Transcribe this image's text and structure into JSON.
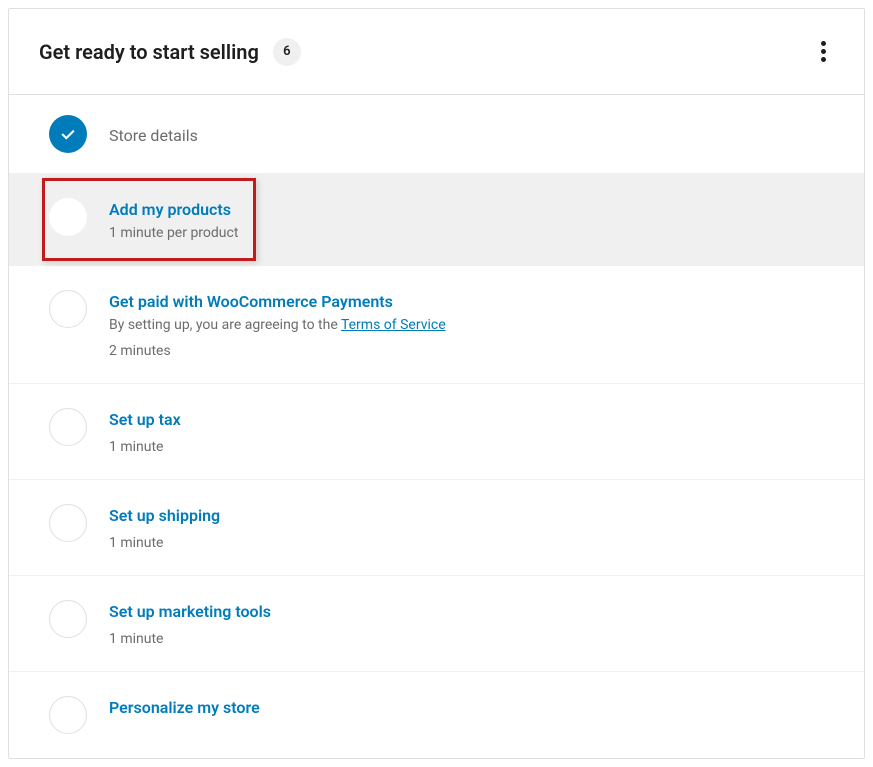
{
  "header": {
    "title": "Get ready to start selling",
    "badge_count": "6"
  },
  "tasks": [
    {
      "title": "Store details",
      "completed": true
    },
    {
      "title": "Add my products",
      "desc": "1 minute per product",
      "selected": true,
      "highlighted": true
    },
    {
      "title": "Get paid with WooCommerce Payments",
      "desc_prefix": "By setting up, you are agreeing to the ",
      "desc_link": "Terms of Service",
      "time": "2 minutes"
    },
    {
      "title": "Set up tax",
      "time": "1 minute"
    },
    {
      "title": "Set up shipping",
      "time": "1 minute"
    },
    {
      "title": "Set up marketing tools",
      "time": "1 minute"
    },
    {
      "title": "Personalize my store"
    }
  ]
}
